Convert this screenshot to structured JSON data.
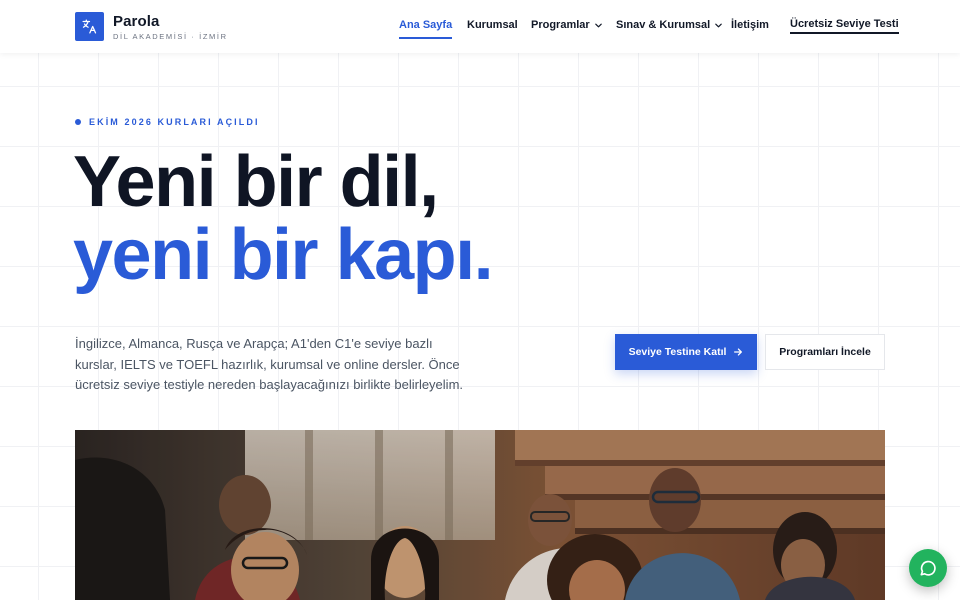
{
  "brand": {
    "name": "Parola",
    "subtitle": "DİL AKADEMİSİ · İZMİR",
    "logo_icon": "translate-icon"
  },
  "nav": {
    "items": [
      {
        "label": "Ana Sayfa",
        "active": true,
        "dropdown": false
      },
      {
        "label": "Kurumsal",
        "active": false,
        "dropdown": false
      },
      {
        "label": "Programlar",
        "active": false,
        "dropdown": true
      },
      {
        "label": "Sınav & Kurumsal",
        "active": false,
        "dropdown": true
      },
      {
        "label": "İletişim",
        "active": false,
        "dropdown": false
      }
    ],
    "cta": "Ücretsiz Seviye Testi"
  },
  "hero": {
    "eyebrow": "EKİM 2026 KURLARI AÇILDI",
    "title_line1": "Yeni bir dil,",
    "title_line2": "yeni bir kapı.",
    "lead": "İngilizce, Almanca, Rusça ve Arapça; A1'den C1'e seviye bazlı kurslar, IELTS ve TOEFL hazırlık, kurumsal ve online dersler. Önce ücretsiz seviye testiyle nereden başlayacağınızı birlikte belirleyelim.",
    "primary_button": "Seviye Testine Katıl",
    "secondary_button": "Programları İncele"
  },
  "photo": {
    "icon": "classroom-students-photo"
  },
  "chat": {
    "icon": "whatsapp-icon"
  },
  "colors": {
    "accent": "#2a5bd7",
    "heading": "#0f1524",
    "body_text": "#4b5563",
    "chat_green": "#22b35e"
  }
}
